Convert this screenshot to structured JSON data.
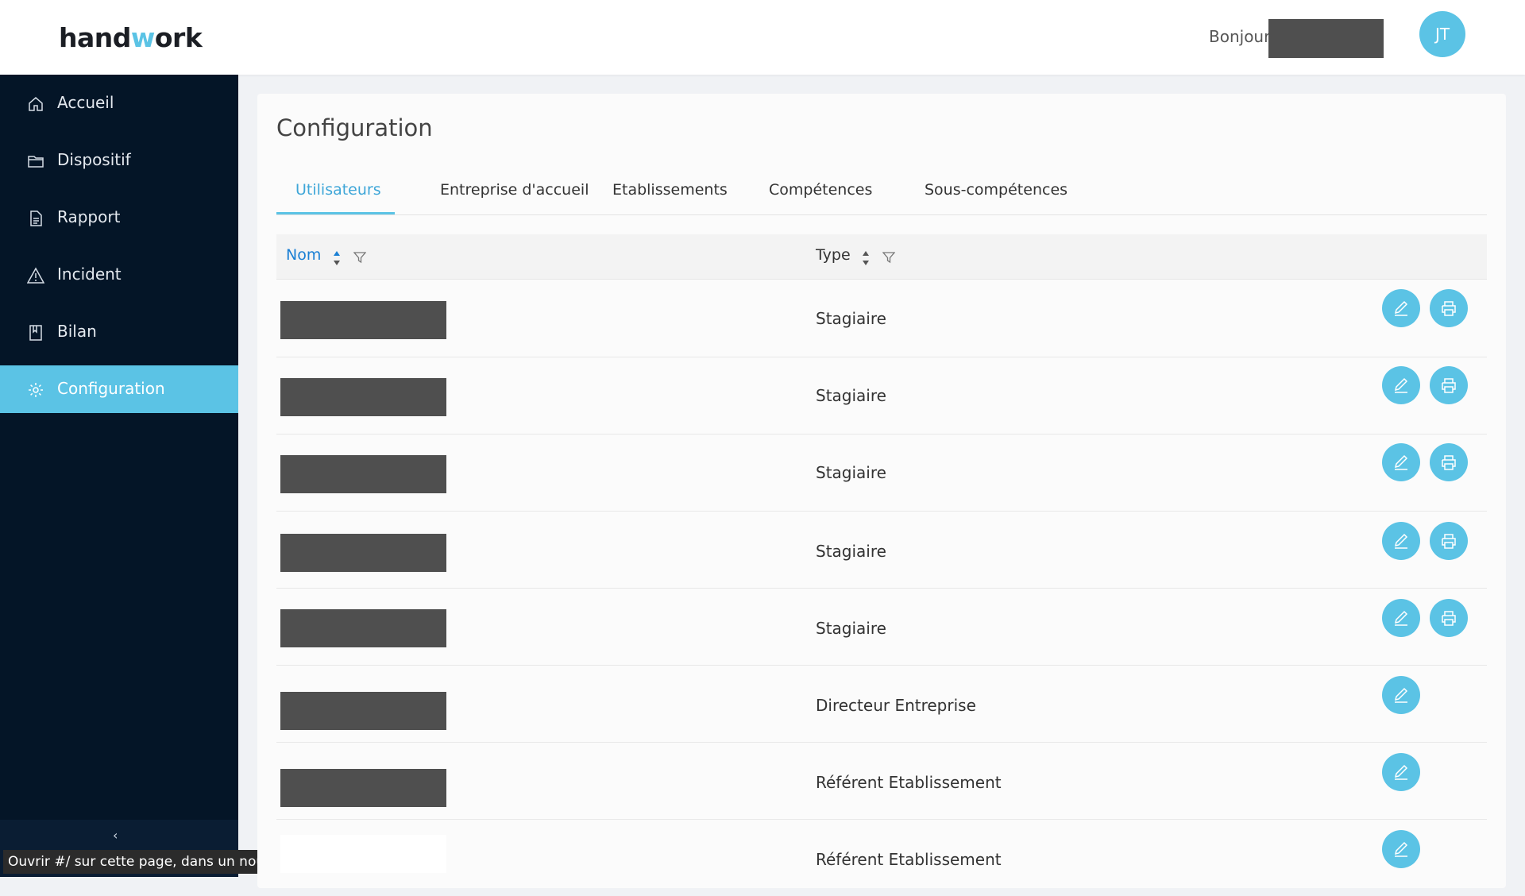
{
  "header": {
    "logo": {
      "part1": "hand",
      "part2": "w",
      "part3": "ork"
    },
    "greeting": "Bonjour",
    "avatar_initials": "JT"
  },
  "sidebar": {
    "items": [
      {
        "label": "Accueil",
        "icon": "home-icon"
      },
      {
        "label": "Dispositif",
        "icon": "folder-icon"
      },
      {
        "label": "Rapport",
        "icon": "document-icon"
      },
      {
        "label": "Incident",
        "icon": "warning-icon"
      },
      {
        "label": "Bilan",
        "icon": "book-icon"
      },
      {
        "label": "Configuration",
        "icon": "gear-icon",
        "active": true
      }
    ],
    "collapse_icon": "collapse-arrow-icon"
  },
  "tooltip": "Ouvrir #/ sur cette page, dans un nouvel",
  "main": {
    "title": "Configuration",
    "tabs": [
      {
        "label": "Utilisateurs",
        "active": true
      },
      {
        "label": "Entreprise d'accueil"
      },
      {
        "label": "Etablissements"
      },
      {
        "label": "Compétences"
      },
      {
        "label": "Sous-compétences"
      }
    ],
    "table": {
      "columns": [
        {
          "label": "Nom",
          "sorted": true
        },
        {
          "label": "Type"
        }
      ],
      "rows": [
        {
          "type": "Stagiaire",
          "actions": [
            "edit",
            "print"
          ]
        },
        {
          "type": "Stagiaire",
          "actions": [
            "edit",
            "print"
          ]
        },
        {
          "type": "Stagiaire",
          "actions": [
            "edit",
            "print"
          ]
        },
        {
          "type": "Stagiaire",
          "actions": [
            "edit",
            "print"
          ]
        },
        {
          "type": "Stagiaire",
          "actions": [
            "edit",
            "print"
          ]
        },
        {
          "type": "Directeur Entreprise",
          "actions": [
            "edit"
          ]
        },
        {
          "type": "Référent Etablissement",
          "actions": [
            "edit"
          ]
        },
        {
          "type": "Référent Etablissement",
          "actions": [
            "edit"
          ]
        }
      ]
    }
  },
  "colors": {
    "accent": "#5bc3e5",
    "sidebar_bg": "#041527",
    "redaction": "#4f4f4f"
  }
}
